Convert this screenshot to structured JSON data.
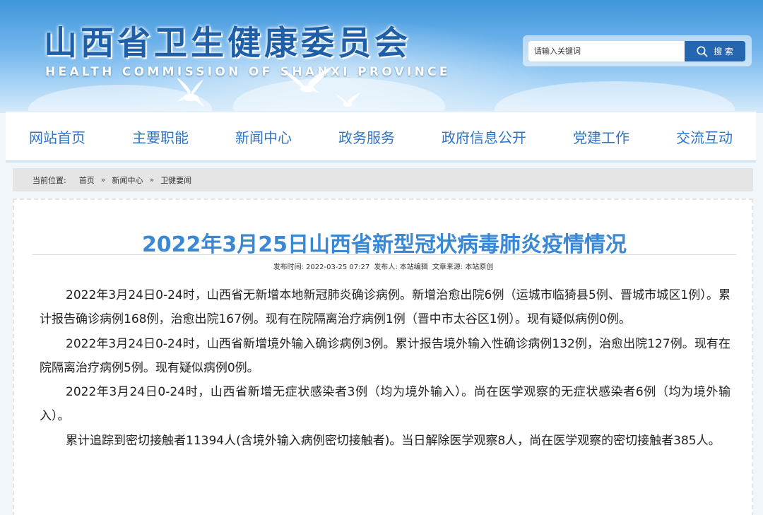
{
  "header": {
    "title": "山西省卫生健康委员会",
    "subtitle": "HEALTH COMMISSION OF SHANXI PROVINCE",
    "search": {
      "placeholder": "请输入关键词",
      "button_label": "搜 索",
      "icon": "search-icon"
    }
  },
  "nav": {
    "items": [
      {
        "label": "网站首页"
      },
      {
        "label": "主要职能"
      },
      {
        "label": "新闻中心"
      },
      {
        "label": "政务服务"
      },
      {
        "label": "政府信息公开"
      },
      {
        "label": "党建工作"
      },
      {
        "label": "交流互动"
      }
    ]
  },
  "breadcrumb": {
    "label": "当前位置:",
    "items": [
      "首页",
      "新闻中心",
      "卫健要闻"
    ],
    "separator": "»"
  },
  "article": {
    "title": "2022年3月25日山西省新型冠状病毒肺炎疫情情况",
    "meta": {
      "date_label": "发布时间:",
      "date": "2022-03-25 07:27",
      "author_label": "发布人:",
      "author": "本站编辑",
      "source_label": "文章来源:",
      "source": "本站原创"
    },
    "paragraphs": [
      "2022年3月24日0-24时，山西省无新增本地新冠肺炎确诊病例。新增治愈出院6例（运城市临猗县5例、晋城市城区1例）。累计报告确诊病例168例，治愈出院167例。现有在院隔离治疗病例1例（晋中市太谷区1例）。现有疑似病例0例。",
      "2022年3月24日0-24时，山西省新增境外输入确诊病例3例。累计报告境外输入性确诊病例132例，治愈出院127例。现有在院隔离治疗病例5例。现有疑似病例0例。",
      "2022年3月24日0-24时，山西省新增无症状感染者3例（均为境外输入）。尚在医学观察的无症状感染者6例（均为境外输入）。",
      "累计追踪到密切接触者11394人(含境外输入病例密切接触者)。当日解除医学观察8人，尚在医学观察的密切接触者385人。"
    ]
  },
  "colors": {
    "brand": "#2566b3",
    "nav_text": "#2f74c4",
    "title": "#3a88d4"
  }
}
